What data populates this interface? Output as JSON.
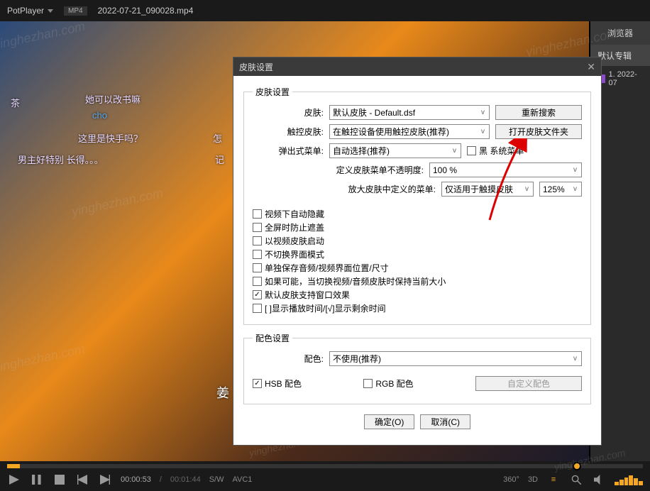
{
  "titlebar": {
    "app": "PotPlayer",
    "format": "MP4",
    "filename": "2022-07-21_090028.mp4"
  },
  "sidebar": {
    "tab": "浏览器",
    "header": "默认专辑",
    "item1": "1. 2022-07"
  },
  "video_subtitles": {
    "s1": "她可以改书嘛",
    "s2": "cho",
    "s3": "这里是快手吗？",
    "s4": "男主好特别 长得。。。",
    "s5": "茶",
    "s6": "怎",
    "s7": "记",
    "s8": "姜"
  },
  "dialog": {
    "title": "皮肤设置",
    "section_skin": "皮肤设置",
    "lbl_skin": "皮肤:",
    "val_skin": "默认皮肤 - Default.dsf",
    "btn_research": "重新搜索",
    "lbl_touch": "触控皮肤:",
    "val_touch": "在触控设备使用触控皮肤(推荐)",
    "btn_openfolder": "打开皮肤文件夹",
    "lbl_popup": "弹出式菜单:",
    "val_popup": "自动选择(推荐)",
    "cb_blackmenu": "黑    系统菜单",
    "lbl_opacity": "定义皮肤菜单不透明度:",
    "val_opacity": "100 %",
    "lbl_zoom": "放大皮肤中定义的菜单:",
    "val_zoom_mode": "仅适用于触摸皮肤",
    "val_zoom_pct": "125%",
    "cb_autohide": "视频下自动隐藏",
    "cb_fullscreen": "全屏时防止遮盖",
    "cb_videoskin": "以视频皮肤启动",
    "cb_noswitch": "不切换界面模式",
    "cb_savesize": "单独保存音频/视频界面位置/尺寸",
    "cb_keepsize": "如果可能，当切换视频/音频皮肤时保持当前大小",
    "cb_windoweffect": "默认皮肤支持窗口效果",
    "cb_timedisplay": "[ ]显示播放时间/[√]显示剩余时间",
    "section_color": "配色设置",
    "lbl_color": "配色:",
    "val_color": "不使用(推荐)",
    "cb_hsb": "HSB 配色",
    "cb_rgb": "RGB 配色",
    "btn_custom": "自定义配色",
    "btn_ok": "确定(O)",
    "btn_cancel": "取消(C)"
  },
  "controls": {
    "current": "00:00:53",
    "total": "00:01:44",
    "sw": "S/W",
    "codec": "AVC1",
    "deg": "360°",
    "threed": "3D"
  },
  "watermark": "yinghezhan.com"
}
